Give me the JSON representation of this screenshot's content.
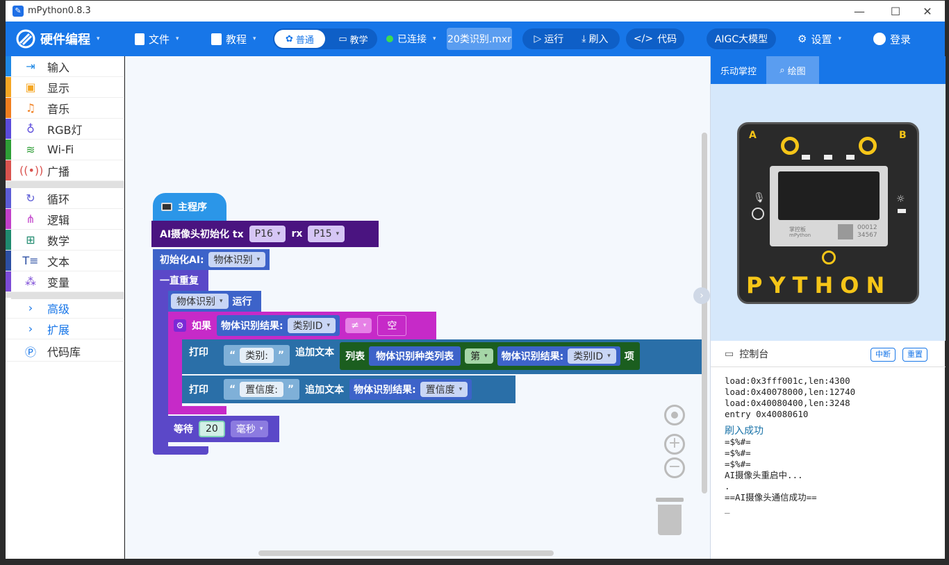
{
  "window": {
    "title": "mPython0.8.3",
    "minimize_icon": "—",
    "maximize_icon": "☐",
    "close_icon": "✕"
  },
  "toolbar": {
    "brand_label": "硬件编程",
    "file_label": "文件",
    "tutorial_label": "教程",
    "mode_normal": "普通",
    "mode_teach": "教学",
    "connection_status": "已连接",
    "status_color": "#3ddc4f",
    "filename": "20类识别.mxr",
    "run_label": "运行",
    "flash_label": "刷入",
    "code_label": "代码",
    "aigc_label": "AIGC大模型",
    "settings_label": "设置",
    "login_label": "登录",
    "accent_color": "#1776e8"
  },
  "sidebar": {
    "items": [
      {
        "label": "输入",
        "icon": "input-icon",
        "color": "#1e88e5"
      },
      {
        "label": "显示",
        "icon": "display-icon",
        "color": "#f5a623"
      },
      {
        "label": "音乐",
        "icon": "music-icon",
        "color": "#f07e1e"
      },
      {
        "label": "RGB灯",
        "icon": "bulb-icon",
        "color": "#5b4bdb"
      },
      {
        "label": "Wi-Fi",
        "icon": "wifi-icon",
        "color": "#2e9e36"
      },
      {
        "label": "广播",
        "icon": "broadcast-icon",
        "color": "#d9534f"
      },
      {
        "label": "循环",
        "icon": "loop-icon",
        "color": "#5c5cd6"
      },
      {
        "label": "逻辑",
        "icon": "logic-icon",
        "color": "#c13fc9"
      },
      {
        "label": "数学",
        "icon": "math-icon",
        "color": "#1f8a6e"
      },
      {
        "label": "文本",
        "icon": "text-icon",
        "color": "#2c4fa3"
      },
      {
        "label": "变量",
        "icon": "variable-icon",
        "color": "#7c4bd6"
      },
      {
        "label": "高级",
        "icon": "chevron-right-icon",
        "color": "#1776e8"
      },
      {
        "label": "扩展",
        "icon": "chevron-right-icon",
        "color": "#1776e8"
      },
      {
        "label": "代码库",
        "icon": "code-library-icon",
        "color": "#1776e8"
      }
    ]
  },
  "blocks": {
    "main_label": "主程序",
    "camera_init": "AI摄像头初始化 tx",
    "tx_pin": "P16",
    "rx_label": "rx",
    "rx_pin": "P15",
    "init_ai": "初始化AI:",
    "init_ai_value": "物体识别",
    "forever": "一直重复",
    "run_mode": "物体识别",
    "run_label": "运行",
    "if_label": "如果",
    "result_label": "物体识别结果:",
    "result_field": "类别ID",
    "neq": "≠",
    "empty": "空",
    "print_label": "打印",
    "str_category": "类别:",
    "append_text": "追加文本",
    "list_label": "列表",
    "class_list": "物体识别种类列表",
    "index_label": "第",
    "item_label": "项",
    "str_conf": "置信度:",
    "conf_field": "置信度",
    "wait_label": "等待",
    "wait_value": "20",
    "wait_unit": "毫秒"
  },
  "right_panel": {
    "tab_active": "乐动掌控",
    "tab_draw": "绘图",
    "board": {
      "button_a": "A",
      "button_b": "B",
      "brand": "掌控板",
      "brand_sub": "mPython",
      "serial_1": "00012",
      "serial_2": "34567",
      "pins_text": "PYTHON"
    },
    "console_title": "控制台",
    "interrupt_label": "中断",
    "reset_label": "重置",
    "console_lines": [
      "load:0x3fff001c,len:4300",
      "load:0x40078000,len:12740",
      "load:0x40080400,len:3248",
      "entry 0x40080610"
    ],
    "flash_success": "刷入成功",
    "console_lines_2": [
      "=$%#=",
      "=$%#=",
      "=$%#=",
      "AI摄像头重启中...",
      ".",
      "==AI摄像头通信成功==",
      "_"
    ]
  }
}
